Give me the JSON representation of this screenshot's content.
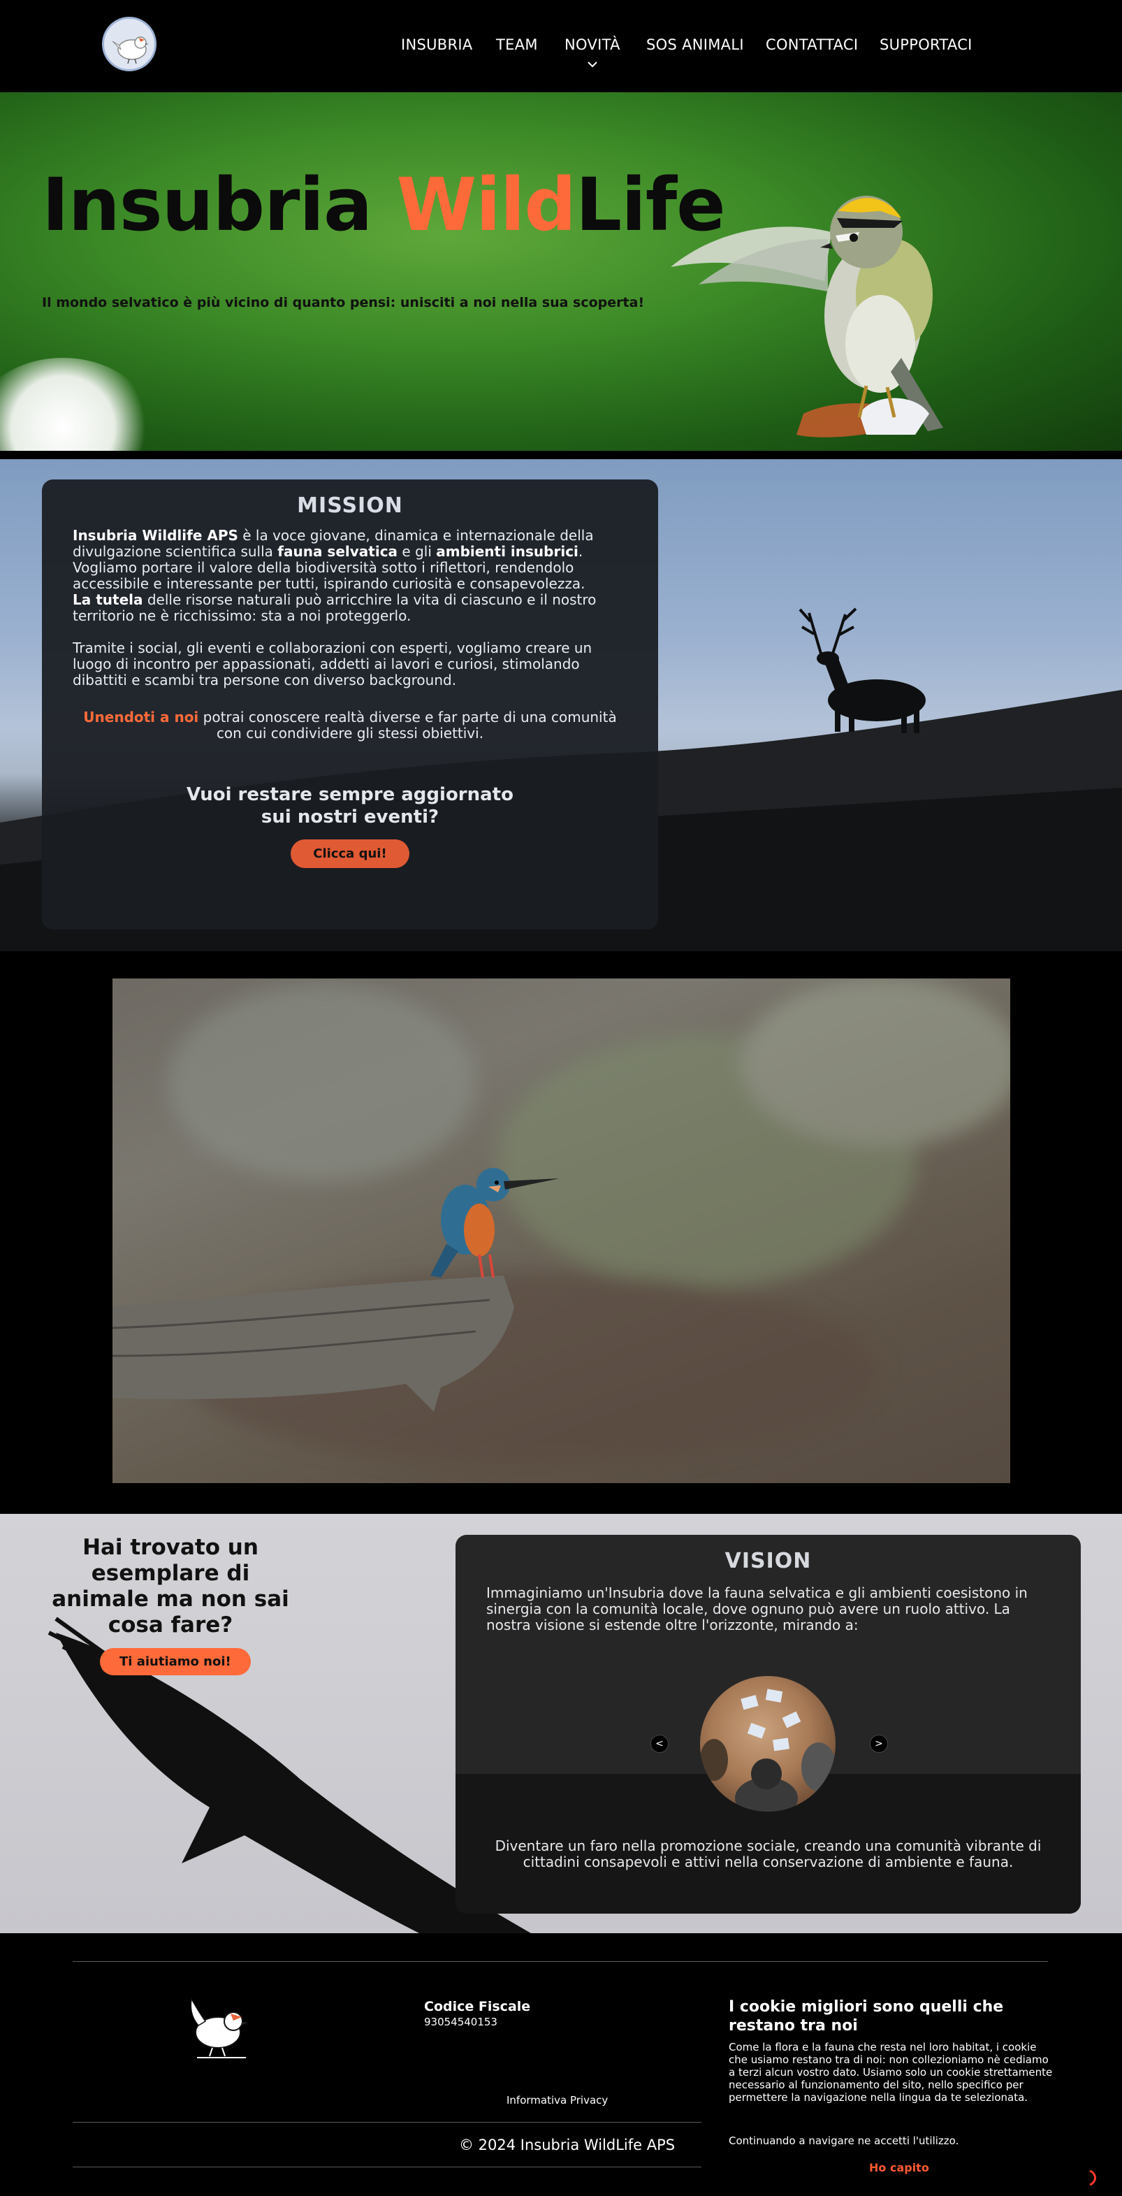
{
  "nav": {
    "logo_alt": "Insubria WildLife logo",
    "items": [
      {
        "label": "INSUBRIA"
      },
      {
        "label": "TEAM"
      },
      {
        "label": "NOVITÀ"
      },
      {
        "label": "SOS ANIMALI"
      },
      {
        "label": "CONTATTACI"
      },
      {
        "label": "SUPPORTACI"
      }
    ],
    "novita_chevron_icon": "chevron-down-icon"
  },
  "hero": {
    "title_part1": "Insubria ",
    "title_part2": "Wild",
    "title_part3": "Life",
    "subtitle": "Il mondo selvatico è più vicino di quanto pensi: unisciti a noi nella sua scoperta!"
  },
  "mission": {
    "title": "MISSION",
    "p1_b1": "Insubria Wildlife APS",
    "p1_t1": " è la voce giovane, dinamica e internazionale della divulgazione scientifica sulla ",
    "p1_b2": "fauna selvatica",
    "p1_t2": " e gli ",
    "p1_b3": "ambienti insubrici",
    "p1_t3": ". Vogliamo portare il valore della biodiversità sotto i riflettori, rendendolo accessibile e interessante per tutti, ispirando curiosità e consapevolezza.",
    "p2_b": "La tutela",
    "p2_t": " delle risorse naturali può arricchire la vita di ciascuno e il nostro territorio ne è ricchissimo: sta a noi proteggerlo.",
    "p3": "Tramite i social, gli eventi e collaborazioni con esperti, vogliamo creare un luogo di incontro per appassionati, addetti ai lavori e curiosi, stimolando dibattiti e scambi tra persone con diverso background.",
    "join_highlight": "Unendoti a noi",
    "join_text": " potrai conoscere realtà diverse e far parte di una comunità con cui condividere gli stessi obiettivi.",
    "question_line1": "Vuoi restare sempre aggiornato",
    "question_line2": "sui nostri eventi?",
    "button": "Clicca qui!"
  },
  "sos": {
    "heading": "Hai trovato un esemplare di animale ma non sai cosa fare?",
    "button": "Ti aiutiamo noi!"
  },
  "vision": {
    "title": "VISION",
    "intro": "Immaginiamo un'Insubria dove la fauna selvatica e gli ambienti coesistono in sinergia con la comunità locale, dove ognuno può avere un ruolo attivo. La nostra visione si estende oltre l'orizzonte, mirando a:",
    "prev": "<",
    "next": ">",
    "slide_text": "Diventare un faro nella promozione sociale, creando una comunità vibrante di cittadini consapevoli e attivi nella conservazione di ambiente e fauna."
  },
  "footer": {
    "cf_label": "Codice Fiscale",
    "cf_value": "93054540153",
    "privacy": "Informativa Privacy",
    "copyright": "© 2024 Insubria WildLife APS",
    "cookie_title": "I cookie migliori sono quelli che restano tra noi",
    "cookie_text": "Come la flora e la fauna che resta nel loro habitat, i cookie che usiamo restano tra di noi: non collezioniamo nè cediamo a terzi alcun vostro dato. Usiamo solo un cookie strettamente necessario al funzionamento del sito, nello specifico per permettere la navigazione nella lingua da te selezionata.",
    "cookie_continue": "Continuando a navigare ne accetti l'utilizzo.",
    "cookie_button": "Ho capito"
  },
  "colors": {
    "accent": "#ff6a3a",
    "button_orange": "#e05a34",
    "card_dark": "#1a1d22",
    "vision_card": "#262626"
  }
}
